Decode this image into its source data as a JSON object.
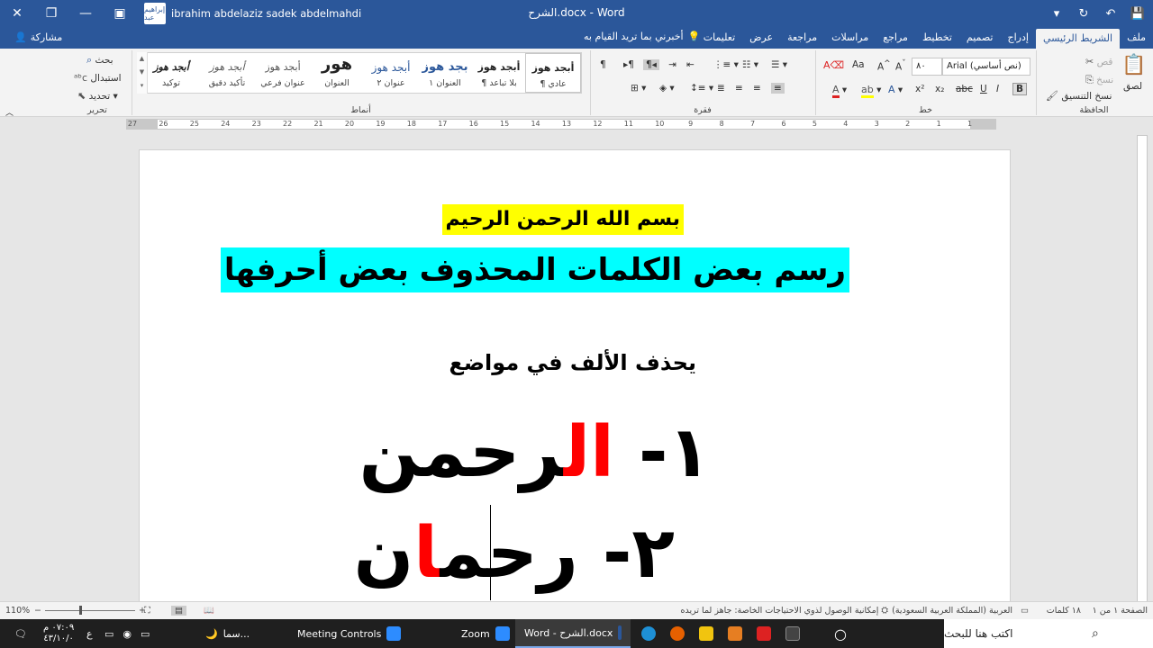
{
  "titlebar": {
    "doc_title": "الشرح.docx  -  Word",
    "user_name": "ibrahim abdelaziz sadek abdelmahdi",
    "avatar_text": "إبراهيم عبد"
  },
  "tabs": {
    "items": [
      "ملف",
      "الشريط الرئيسي",
      "إدراج",
      "تصميم",
      "تخطيط",
      "مراجع",
      "مراسلات",
      "مراجعة",
      "عرض",
      "تعليمات"
    ],
    "active_index": 1,
    "tell_me": "أخبرني بما تريد القيام به",
    "share": "مشاركة"
  },
  "ribbon": {
    "clipboard": {
      "label": "الحافظة",
      "paste": "لصق",
      "cut": "قص",
      "copy": "نسخ",
      "format_painter": "نسخ التنسيق"
    },
    "font": {
      "label": "خط",
      "font_name": "Arial (نص أساسي)",
      "font_size": "٨٠"
    },
    "paragraph": {
      "label": "فقرة"
    },
    "styles": {
      "label": "أنماط",
      "items": [
        {
          "preview": "أبجد هوز",
          "name": "¶ عادي"
        },
        {
          "preview": "أبجد هوز",
          "name": "¶ بلا تباعد"
        },
        {
          "preview": "بجد هوز",
          "name": "العنوان ١"
        },
        {
          "preview": "أبجد هوز",
          "name": "عنوان ٢"
        },
        {
          "preview": "هور",
          "name": "العنوان"
        },
        {
          "preview": "أبجد هوز",
          "name": "عنوان فرعي"
        },
        {
          "preview": "أبجد هوز",
          "name": "تأكيد دقيق"
        },
        {
          "preview": "أبجد هوز",
          "name": "توكيد"
        }
      ]
    },
    "editing": {
      "label": "تحرير",
      "find": "بحث",
      "replace": "استبدال",
      "select": "تحديد"
    }
  },
  "ruler": {
    "ticks": [
      "27",
      "26",
      "25",
      "24",
      "23",
      "22",
      "21",
      "20",
      "19",
      "18",
      "17",
      "16",
      "15",
      "14",
      "13",
      "12",
      "11",
      "10",
      "9",
      "8",
      "7",
      "6",
      "5",
      "4",
      "3",
      "2",
      "1",
      "1"
    ]
  },
  "document": {
    "basmala": "بسم الله الرحمن الرحيم",
    "title": "رسم بعض الكلمات المحذوف بعض أحرفها",
    "subtitle": "يحذف الألف في مواضع",
    "line1": {
      "num": "١- ",
      "pre": "",
      "red": "ال",
      "post": "رحمن"
    },
    "line2": {
      "num": "٢- ",
      "pre": "رحم",
      "red": "ا",
      "post": "ن"
    }
  },
  "statusbar": {
    "page": "الصفحة ١ من ١",
    "words": "١٨ كلمات",
    "language": "العربية (المملكة العربية السعودية)",
    "accessibility": "إمكانية الوصول لذوي الاحتياجات الخاصة: جاهز لما تريده",
    "zoom": "110%"
  },
  "taskbar": {
    "search_placeholder": "اكتب هنا للبحث",
    "word_app": "Word - الشرح.docx",
    "zoom_app": "Zoom",
    "meeting_controls": "Meeting Controls",
    "weather": "سما...",
    "time": "٠٧:٠٩ م",
    "date": "٤٣/١٠/٠",
    "lang": "ع"
  },
  "colors": {
    "word_blue": "#2b579a",
    "highlight_yellow": "#ffff00",
    "highlight_cyan": "#00ffff",
    "text_red": "#ff0000"
  }
}
